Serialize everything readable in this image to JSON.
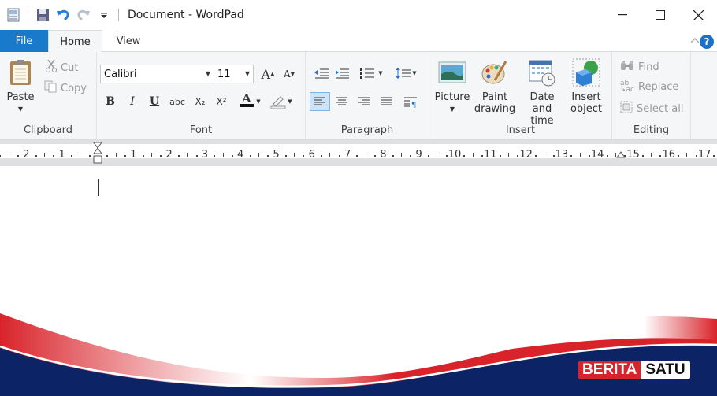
{
  "window": {
    "title": "Document - WordPad",
    "icons": {
      "app": "wordpad-app-icon",
      "save": "save-icon",
      "undo": "undo-icon",
      "redo": "redo-icon",
      "customize": "customize-quick-access-icon"
    },
    "controls": {
      "minimize": "—",
      "maximize": "☐",
      "close": "✕"
    }
  },
  "tabs": [
    {
      "label": "File",
      "active": false
    },
    {
      "label": "Home",
      "active": true
    },
    {
      "label": "View",
      "active": false
    }
  ],
  "help": {
    "label": "?",
    "collapse": "^"
  },
  "ribbon": {
    "clipboard": {
      "label": "Clipboard",
      "paste": "Paste",
      "cut": "Cut",
      "copy": "Copy"
    },
    "font": {
      "label": "Font",
      "family": "Calibri",
      "size": "11",
      "grow": "A",
      "shrink": "A",
      "bold": "B",
      "italic": "I",
      "underline": "U",
      "strikethrough": "abc",
      "subscript": "X₂",
      "superscript": "X²",
      "color": "A"
    },
    "paragraph": {
      "label": "Paragraph"
    },
    "insert": {
      "label": "Insert",
      "picture": "Picture",
      "paint1": "Paint",
      "paint2": "drawing",
      "date1": "Date and",
      "date2": "time",
      "object1": "Insert",
      "object2": "object"
    },
    "editing": {
      "label": "Editing",
      "find": "Find",
      "replace": "Replace",
      "select_all": "Select all"
    }
  },
  "ruler": {
    "left_numbers": [
      "2",
      "1"
    ],
    "right_numbers": [
      "1",
      "2",
      "3",
      "4",
      "5",
      "6",
      "7",
      "8",
      "9",
      "10",
      "11",
      "12",
      "13",
      "14",
      "15",
      "16",
      "17"
    ]
  },
  "watermark": {
    "part1": "BERITA",
    "part2": "SATU",
    "red": "#d9232a",
    "navy": "#0c2466"
  }
}
